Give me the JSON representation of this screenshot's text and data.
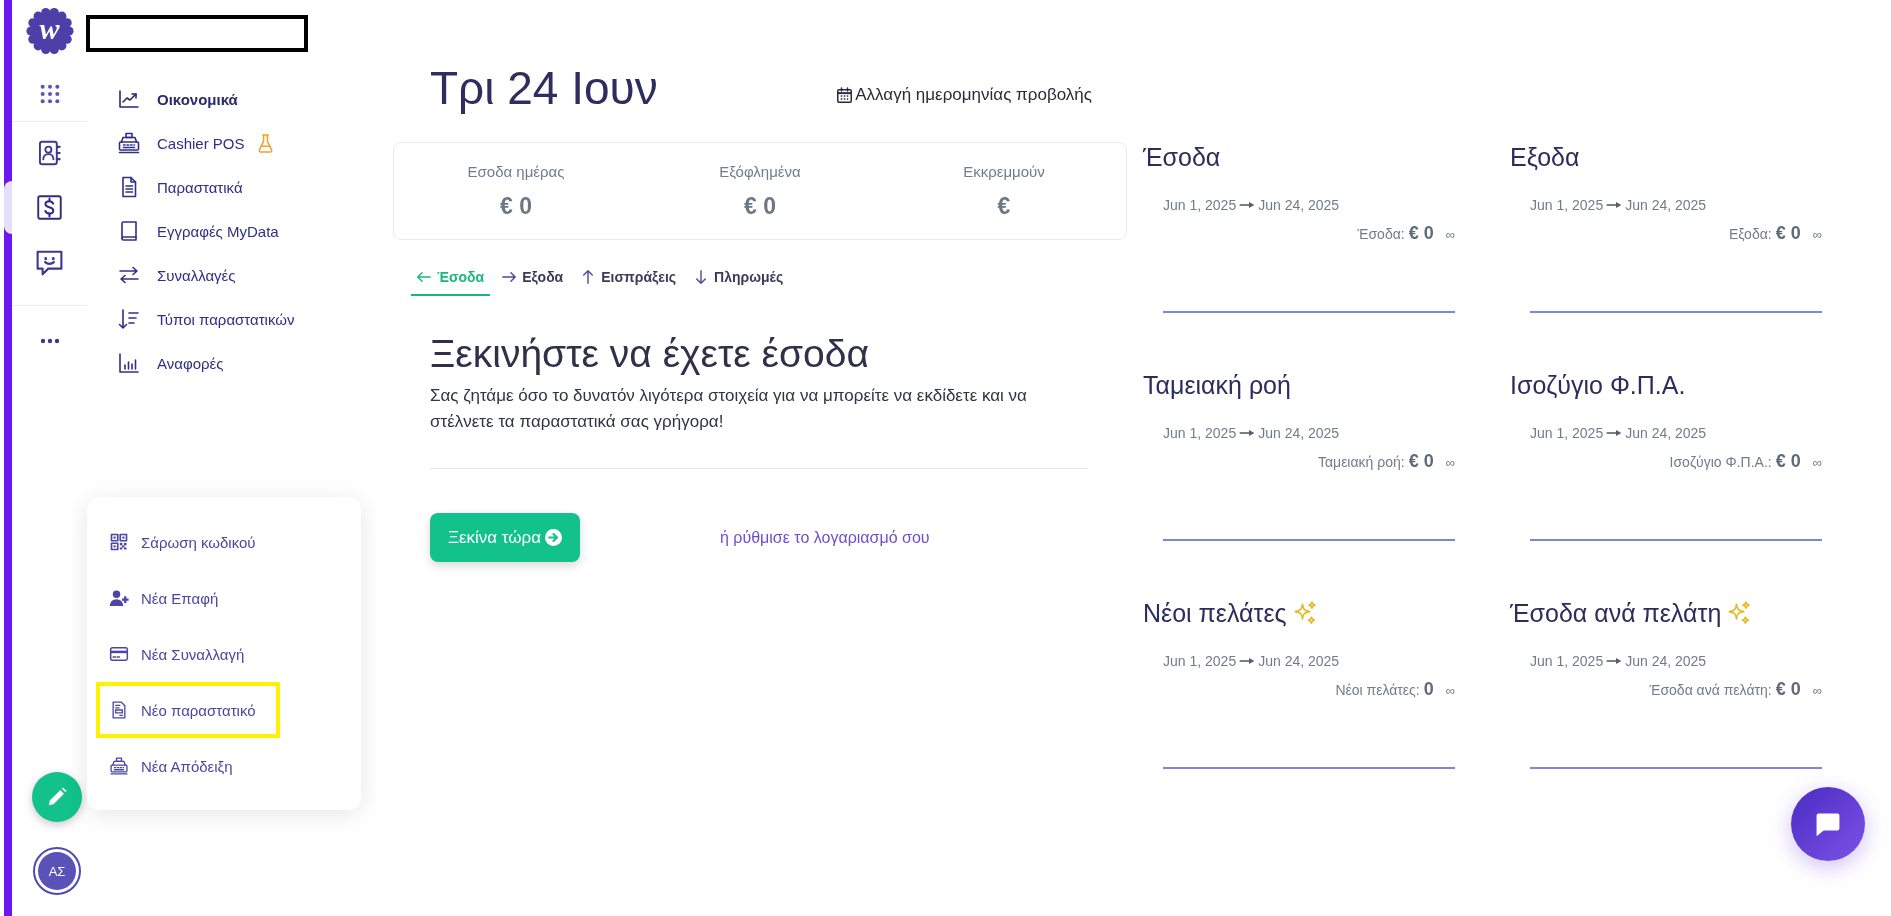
{
  "brand": {
    "logo_letter": "w"
  },
  "rail": {
    "sections": [
      {
        "items": [
          {
            "kind": "apps",
            "selected": false
          }
        ]
      },
      {
        "items": [
          {
            "kind": "contacts",
            "selected": false
          },
          {
            "kind": "dollar",
            "selected": true
          },
          {
            "kind": "chat",
            "selected": false
          }
        ]
      },
      {
        "items": [
          {
            "kind": "more",
            "selected": false
          }
        ]
      }
    ]
  },
  "sidebar": {
    "items": [
      {
        "label": "Οικονομικά",
        "kind": "chart",
        "selected": true,
        "experimental": false
      },
      {
        "label": "Cashier POS",
        "kind": "register",
        "selected": false,
        "experimental": true
      },
      {
        "label": "Παραστατικά",
        "kind": "document",
        "selected": false,
        "experimental": false
      },
      {
        "label": "Εγγραφές MyData",
        "kind": "book",
        "selected": false,
        "experimental": false
      },
      {
        "label": "Συναλλαγές",
        "kind": "exchange",
        "selected": false,
        "experimental": false
      },
      {
        "label": "Τύποι παραστατικών",
        "kind": "sort",
        "selected": false,
        "experimental": false
      },
      {
        "label": "Αναφορές",
        "kind": "bars",
        "selected": false,
        "experimental": false
      }
    ]
  },
  "header": {
    "date": "Τρι 24 Ιουν",
    "change_date": "Αλλαγή ημερομηνίας προβολής"
  },
  "stats": [
    {
      "label": "Εσοδα ημέρας",
      "value": "€ 0"
    },
    {
      "label": "Εξόφλημένα",
      "value": "€ 0"
    },
    {
      "label": "Εκκρεμμούν",
      "value": "€"
    }
  ],
  "tabs": [
    {
      "label": "Έσοδα",
      "kind": "left",
      "selected": true
    },
    {
      "label": "Εξοδα",
      "kind": "right",
      "selected": false
    },
    {
      "label": "Εισπράξεις",
      "kind": "up",
      "selected": false
    },
    {
      "label": "Πληρωμές",
      "kind": "down",
      "selected": false
    }
  ],
  "empty_state": {
    "heading": "Ξεκινήστε να έχετε έσοδα",
    "text": "Σας ζητάμε όσο το δυνατόν λιγότερα στοιχεία για να μπορείτε να εκδίδετε και να στέλνετε τα παραστατικά σας γρήγορα!",
    "button": "Ξεκίνα τώρα",
    "link": "ή ρύθμισε το λογαριασμό σου"
  },
  "widgets": [
    {
      "title": "Έσοδα",
      "sparkle": false,
      "date_from": "Jun 1, 2025",
      "date_to": "Jun 24, 2025",
      "summary_label": "Έσοδα:",
      "summary_value": "€ 0",
      "trend": "∞"
    },
    {
      "title": "Εξοδα",
      "sparkle": false,
      "date_from": "Jun 1, 2025",
      "date_to": "Jun 24, 2025",
      "summary_label": "Εξοδα:",
      "summary_value": "€ 0",
      "trend": "∞"
    },
    {
      "title": "Ταμειακή ροή",
      "sparkle": false,
      "date_from": "Jun 1, 2025",
      "date_to": "Jun 24, 2025",
      "summary_label": "Ταμειακή ροή:",
      "summary_value": "€ 0",
      "trend": "∞"
    },
    {
      "title": "Ισοζύγιο Φ.Π.Α.",
      "sparkle": false,
      "date_from": "Jun 1, 2025",
      "date_to": "Jun 24, 2025",
      "summary_label": "Ισοζύγιο Φ.Π.Α.:",
      "summary_value": "€ 0",
      "trend": "∞"
    },
    {
      "title": "Νέοι πελάτες",
      "sparkle": true,
      "date_from": "Jun 1, 2025",
      "date_to": "Jun 24, 2025",
      "summary_label": "Νέοι πελάτες:",
      "summary_value": "0",
      "trend": "∞"
    },
    {
      "title": "Έσοδα ανά πελάτη",
      "sparkle": true,
      "date_from": "Jun 1, 2025",
      "date_to": "Jun 24, 2025",
      "summary_label": "Έσοδα ανά πελάτη:",
      "summary_value": "€ 0",
      "trend": "∞"
    }
  ],
  "quick_menu": {
    "items": [
      {
        "label": "Σάρωση κωδικού",
        "kind": "qr",
        "highlighted": false
      },
      {
        "label": "Νέα Επαφή",
        "kind": "contact-add",
        "highlighted": false
      },
      {
        "label": "Νέα Συναλλαγή",
        "kind": "card",
        "highlighted": false
      },
      {
        "label": "Νέο παραστατικό",
        "kind": "invoice",
        "highlighted": true
      },
      {
        "label": "Νέα Απόδειξη",
        "kind": "register",
        "highlighted": false
      }
    ]
  },
  "user": {
    "initials": "ΑΣ"
  }
}
